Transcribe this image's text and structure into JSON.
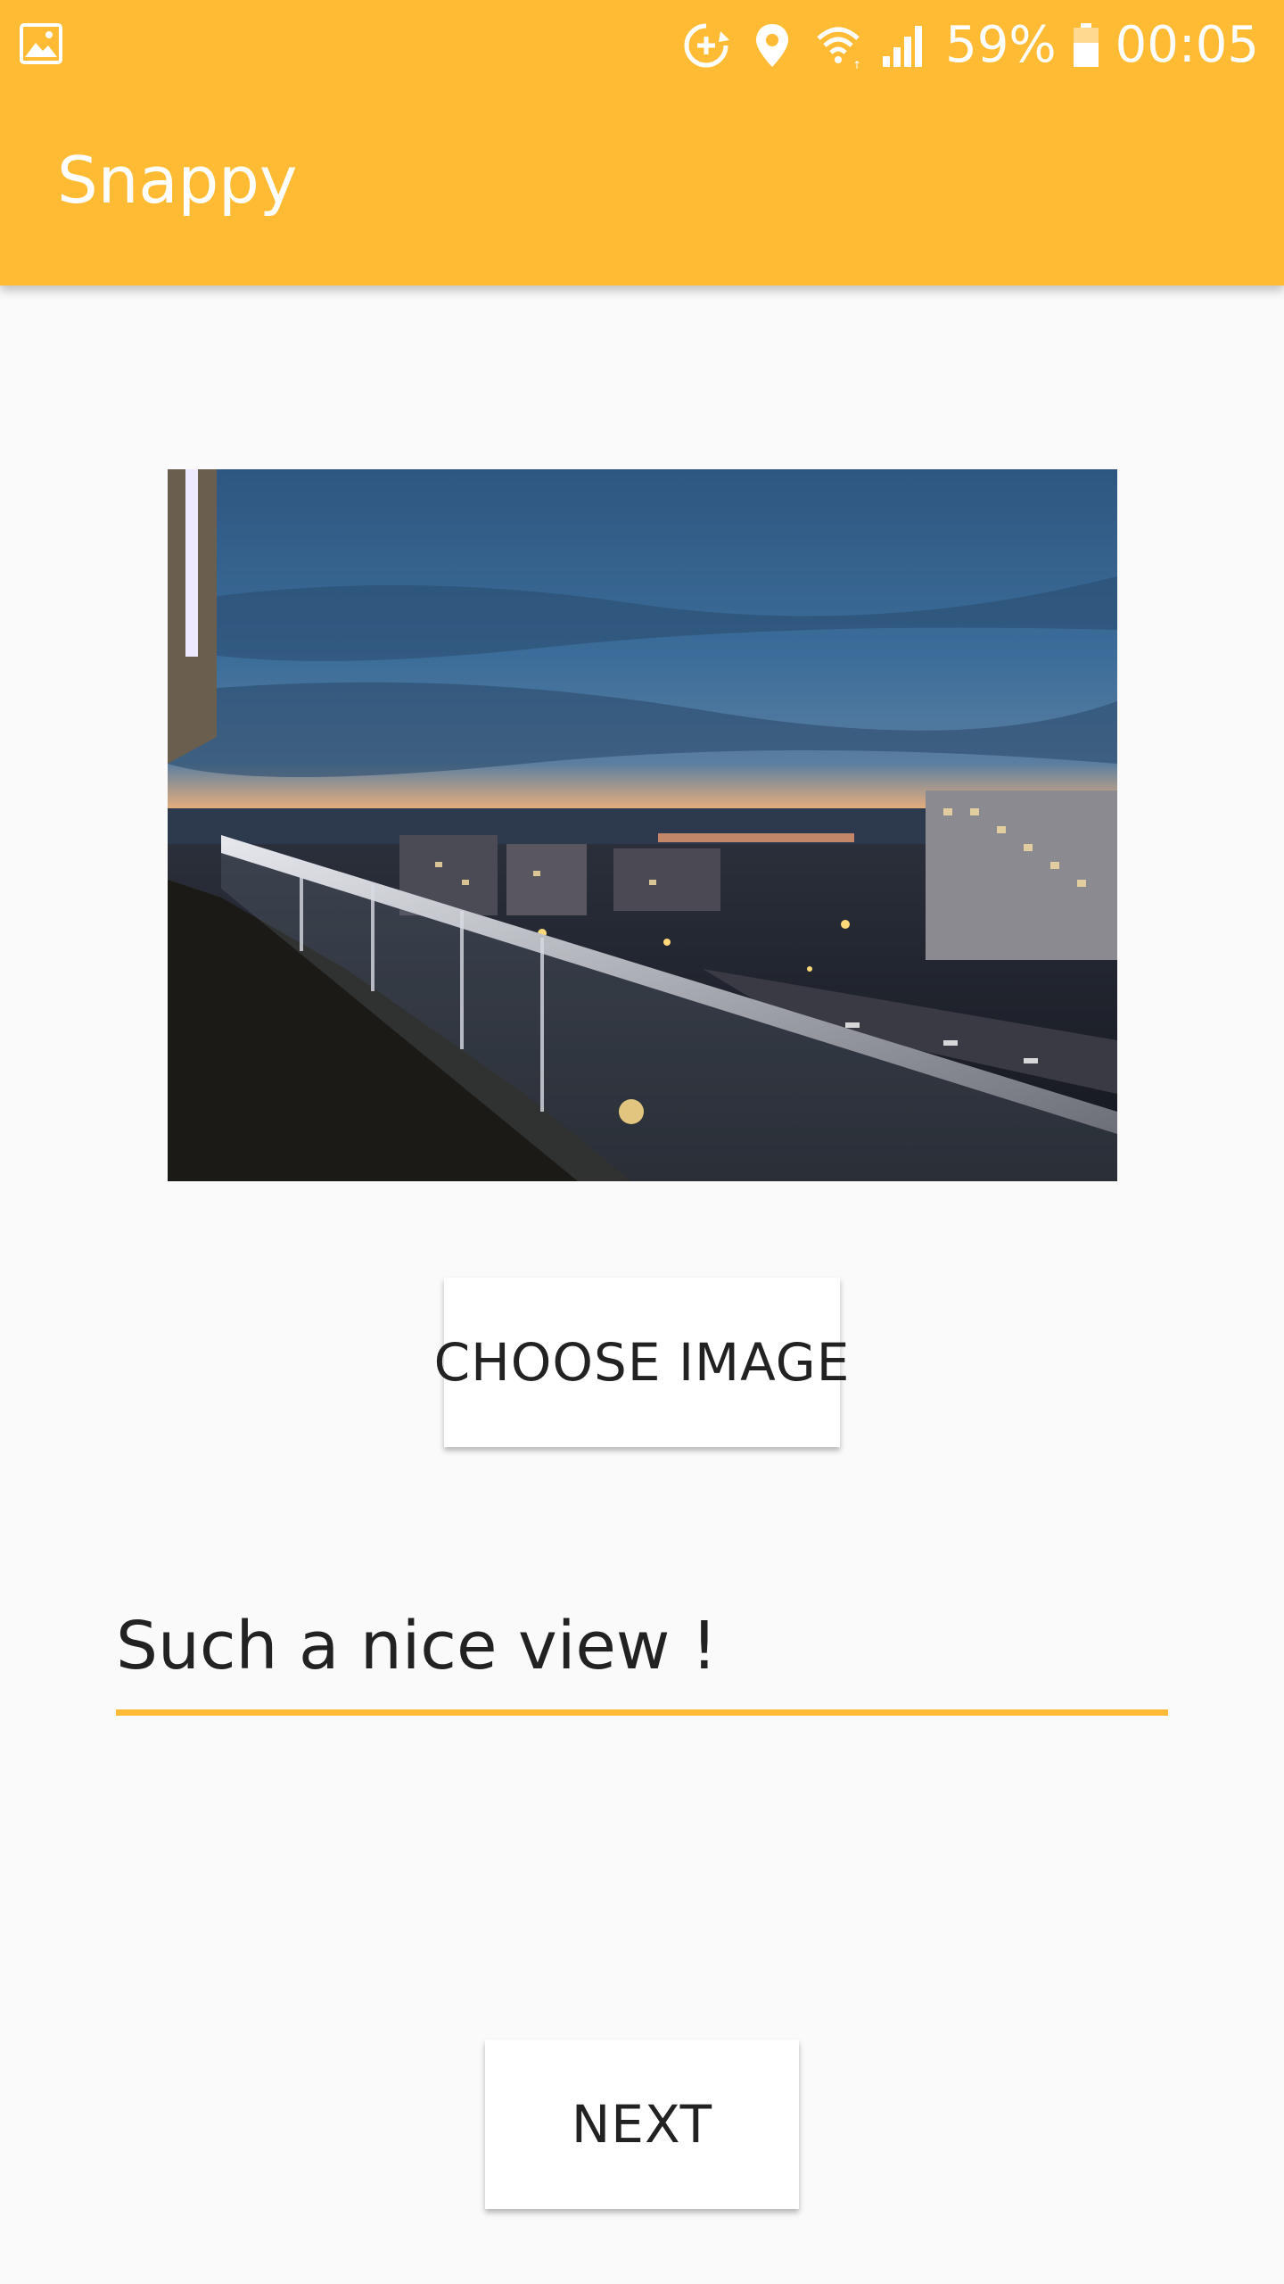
{
  "status_bar": {
    "battery_percent": "59%",
    "time": "00:05",
    "icons": [
      "image-icon",
      "sync-plus-icon",
      "location-pin-icon",
      "wifi-icon",
      "cell-signal-icon",
      "battery-icon"
    ]
  },
  "app_bar": {
    "title": "Snappy",
    "color": "#ffbb33"
  },
  "content": {
    "photo_icon": "night-city-balcony-photo",
    "choose_button_label": "CHOOSE IMAGE",
    "caption_value": "Such a nice view !",
    "next_button_label": "NEXT"
  }
}
